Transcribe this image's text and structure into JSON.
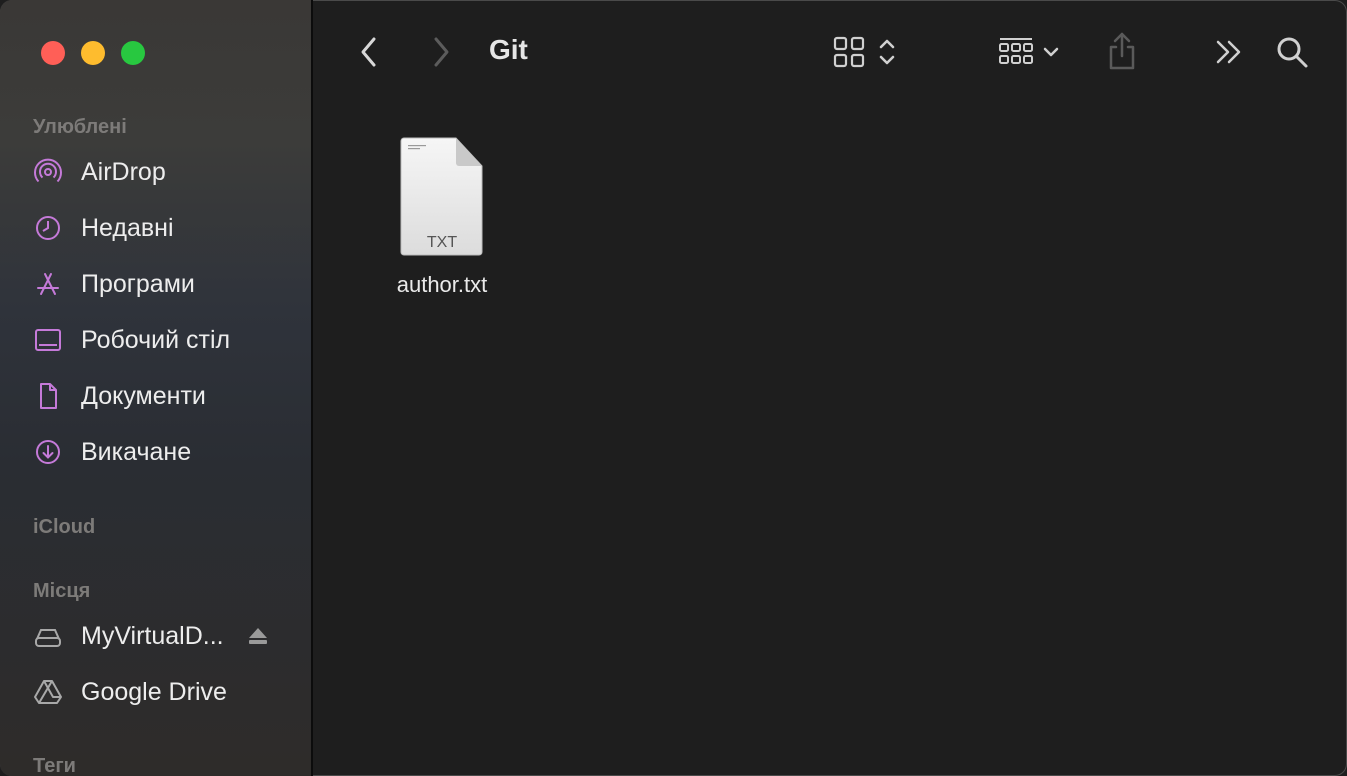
{
  "window": {
    "title": "Git"
  },
  "sidebar": {
    "favorites_title": "Улюблені",
    "favorites": [
      {
        "label": "AirDrop",
        "icon": "airdrop-icon"
      },
      {
        "label": "Недавні",
        "icon": "clock-icon"
      },
      {
        "label": "Програми",
        "icon": "applications-icon"
      },
      {
        "label": "Робочий стіл",
        "icon": "desktop-icon"
      },
      {
        "label": "Документи",
        "icon": "document-icon"
      },
      {
        "label": "Викачане",
        "icon": "download-icon"
      }
    ],
    "icloud_title": "iCloud",
    "places_title": "Місця",
    "places": [
      {
        "label": "MyVirtualD...",
        "icon": "drive-icon"
      },
      {
        "label": "Google Drive",
        "icon": "google-drive-icon"
      }
    ],
    "tags_title": "Теги"
  },
  "files": [
    {
      "name": "author.txt",
      "ext": "TXT",
      "icon": "text-file-icon"
    }
  ],
  "colors": {
    "accent": "#c57ad9",
    "background": "#1e1e1e",
    "close": "#ff5f57",
    "minimize": "#febc2e",
    "maximize": "#28c840"
  }
}
